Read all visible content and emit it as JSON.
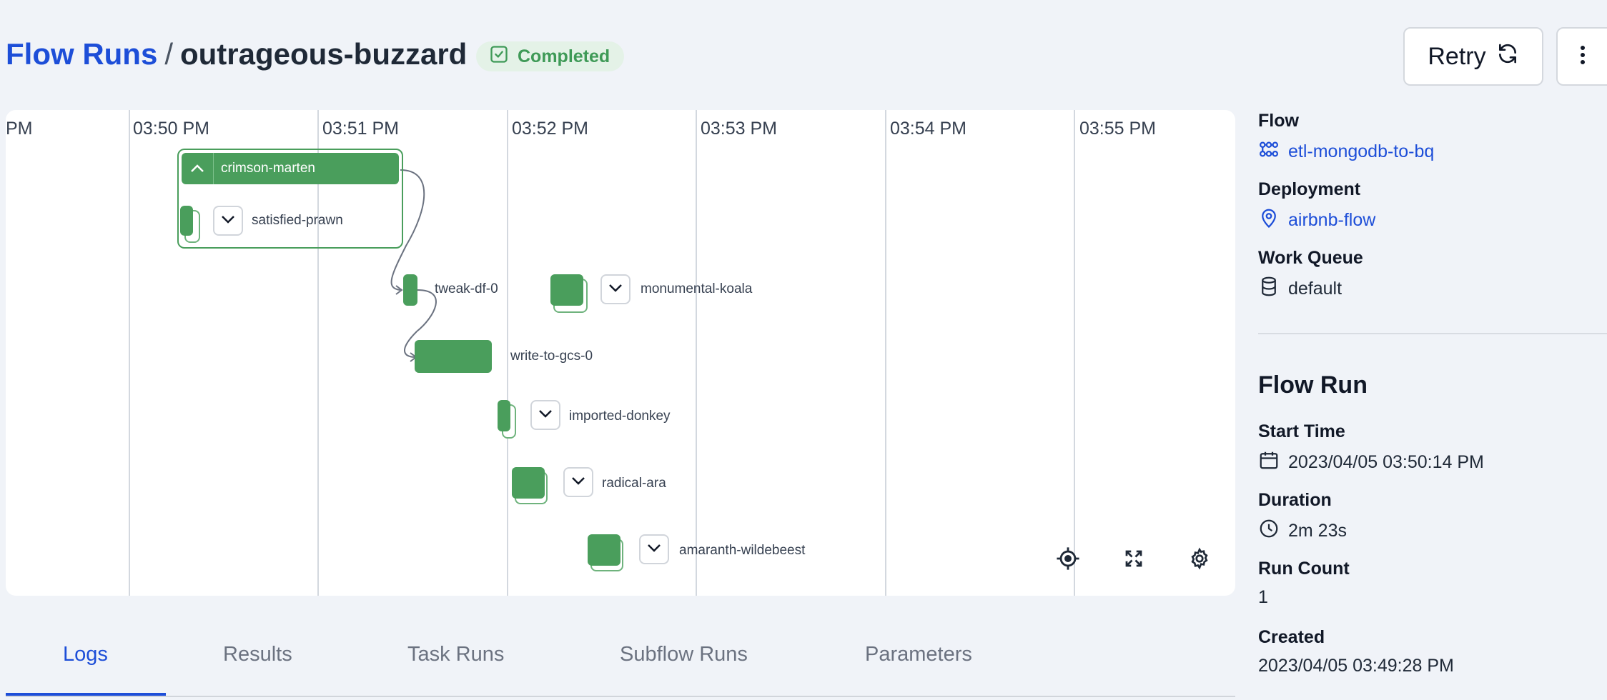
{
  "header": {
    "breadcrumb_root": "Flow Runs",
    "separator": "/",
    "run_name": "outrageous-buzzard",
    "status": "Completed",
    "retry_label": "Retry"
  },
  "graph": {
    "time_labels": [
      "PM",
      "03:50 PM",
      "03:51 PM",
      "03:52 PM",
      "03:53 PM",
      "03:54 PM",
      "03:55 PM"
    ],
    "nodes": {
      "crimson_marten": "crimson-marten",
      "satisfied_prawn": "satisfied-prawn",
      "tweak_df": "tweak-df-0",
      "monumental_koala": "monumental-koala",
      "write_to_gcs": "write-to-gcs-0",
      "imported_donkey": "imported-donkey",
      "radical_ara": "radical-ara",
      "amaranth_wildebeest": "amaranth-wildebeest"
    },
    "tools": [
      "recenter-icon",
      "fullscreen-icon",
      "settings-icon"
    ]
  },
  "tabs": [
    "Logs",
    "Results",
    "Task Runs",
    "Subflow Runs",
    "Parameters"
  ],
  "active_tab": "Logs",
  "sidebar": {
    "flow_label": "Flow",
    "flow_value": "etl-mongodb-to-bq",
    "deployment_label": "Deployment",
    "deployment_value": "airbnb-flow",
    "work_queue_label": "Work Queue",
    "work_queue_value": "default",
    "flow_run_heading": "Flow Run",
    "start_time_label": "Start Time",
    "start_time_value": "2023/04/05 03:50:14 PM",
    "duration_label": "Duration",
    "duration_value": "2m 23s",
    "run_count_label": "Run Count",
    "run_count_value": "1",
    "created_label": "Created",
    "created_value": "2023/04/05 03:49:28 PM"
  },
  "colors": {
    "brand_blue": "#1d4ed8",
    "completed_green": "#4a9e5c",
    "badge_bg": "#e4f2e7"
  }
}
